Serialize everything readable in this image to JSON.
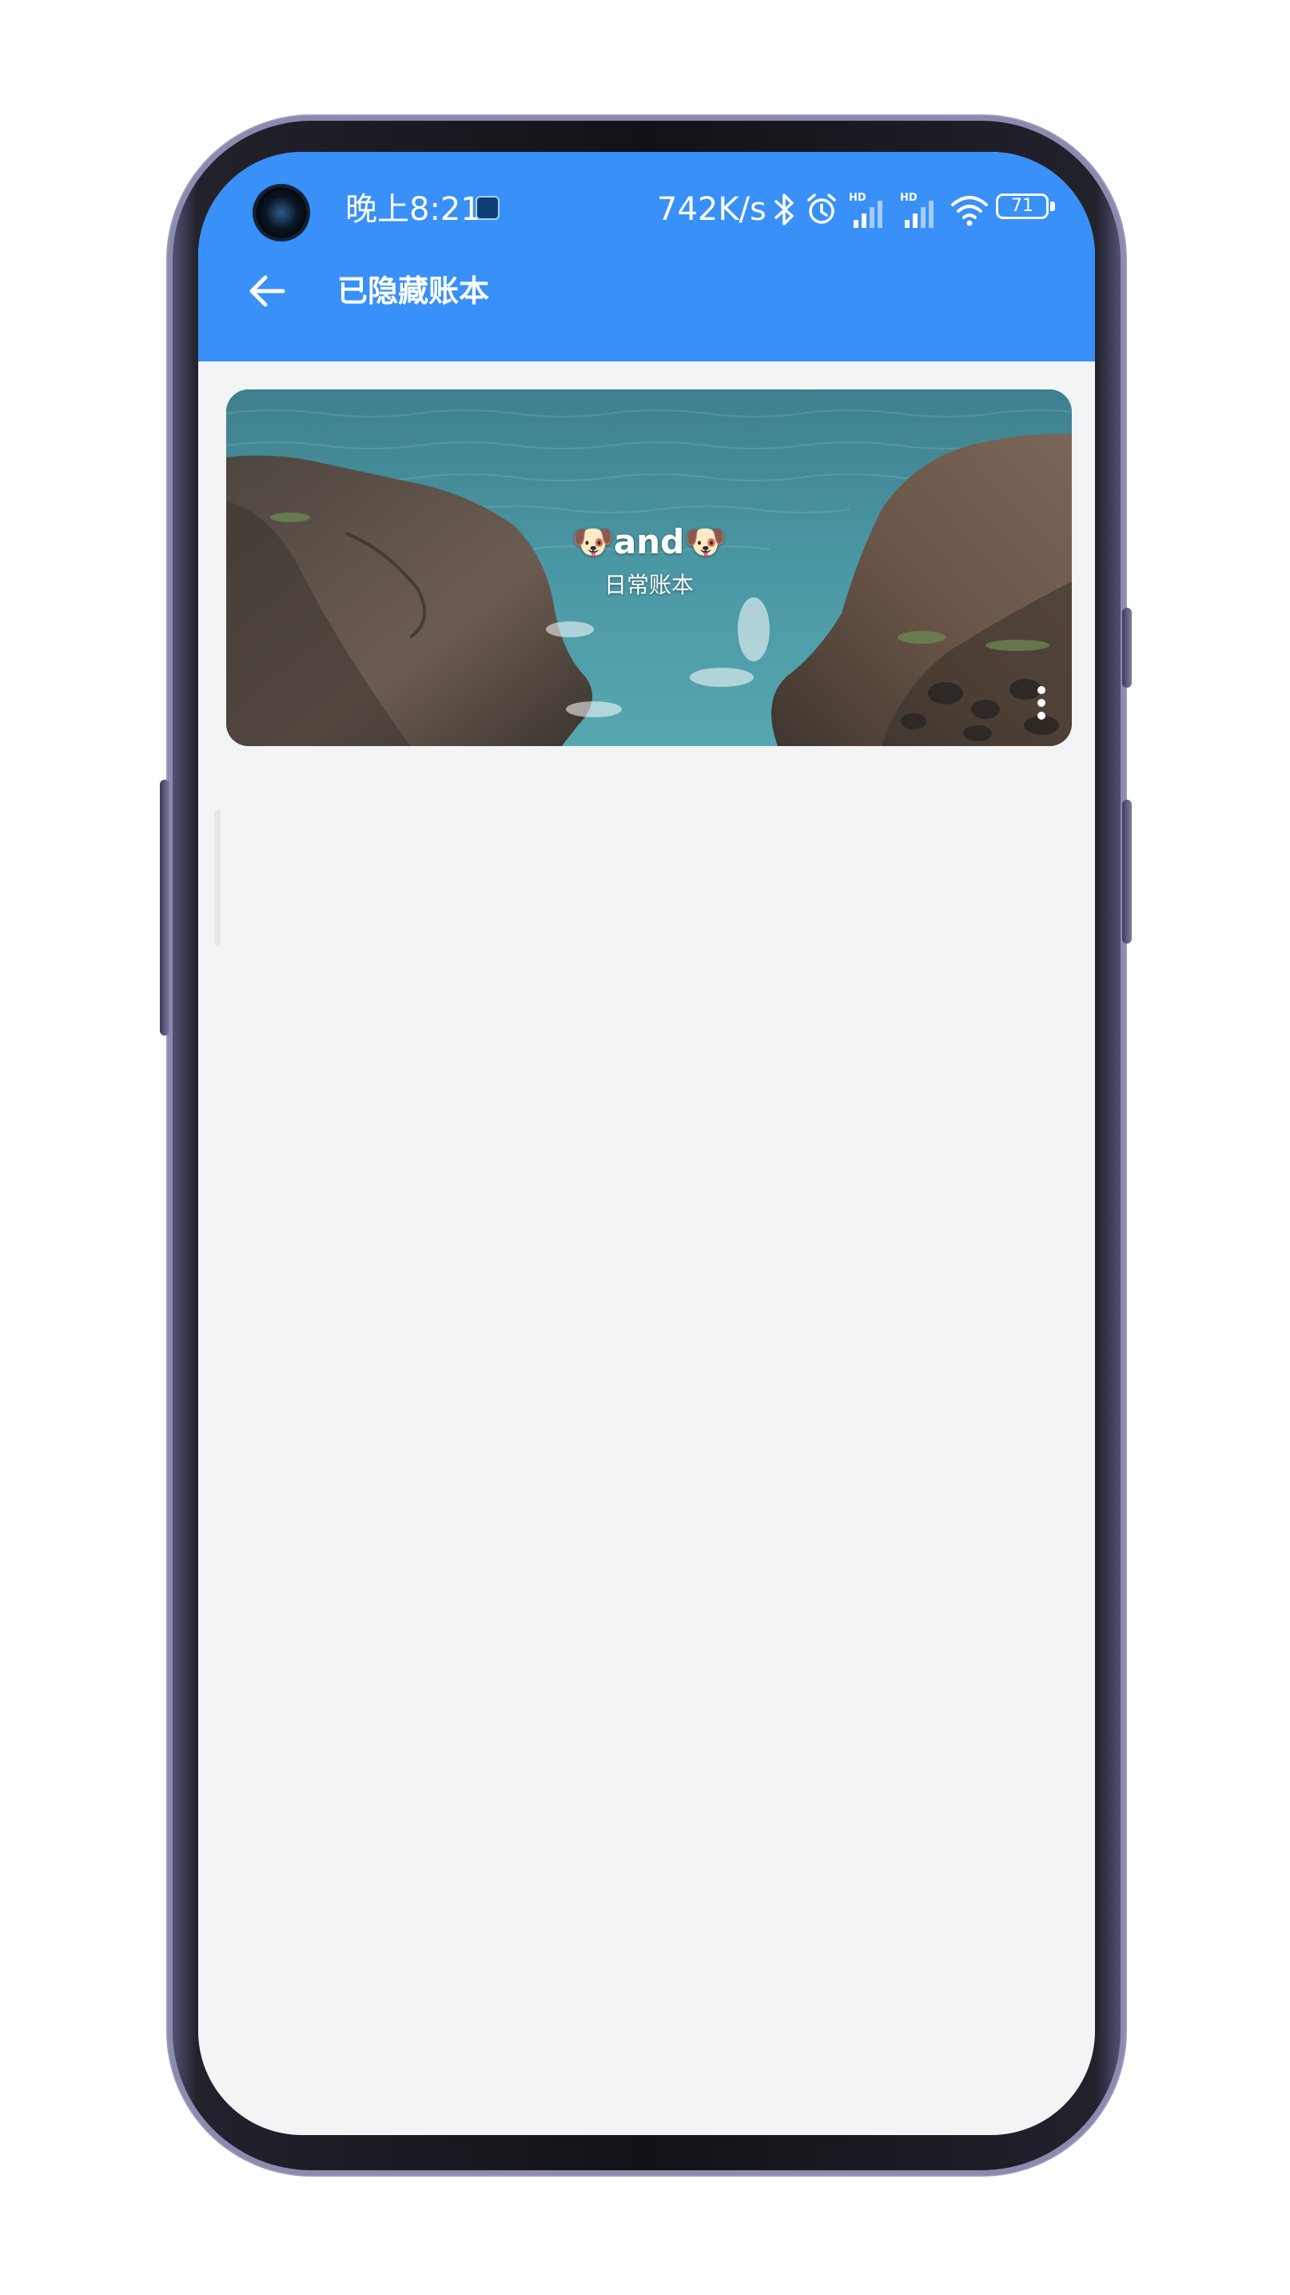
{
  "status_bar": {
    "time": "晚上8:21",
    "network_speed": "742K/s",
    "battery_level": "71",
    "icons": [
      "bluetooth-icon",
      "alarm-icon",
      "signal-hd-1-icon",
      "signal-hd-2-icon",
      "wifi-icon",
      "battery-icon"
    ]
  },
  "app_bar": {
    "title": "已隐藏账本",
    "back_icon": "arrow-left-icon",
    "background_color": "#3890f8"
  },
  "ledgers": [
    {
      "name": "🐶and🐶",
      "type": "日常账本",
      "background": "sea-rocks-photo",
      "menu_icon": "more-vertical-icon"
    }
  ],
  "colors": {
    "accent": "#3890f8",
    "page_background": "#f3f4f6"
  }
}
